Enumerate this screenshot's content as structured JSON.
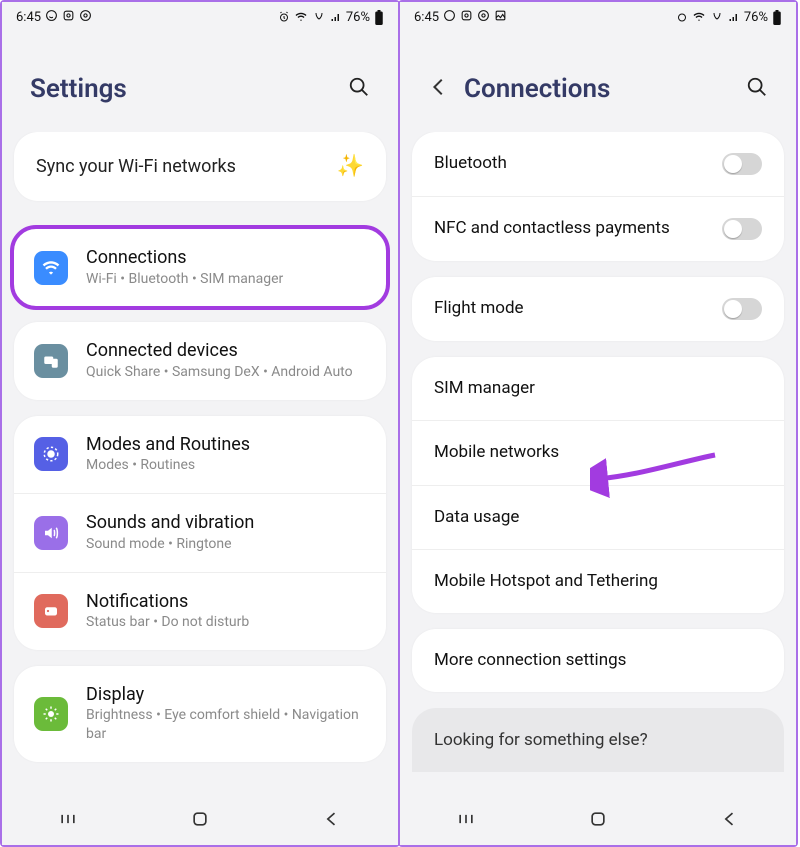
{
  "status": {
    "time": "6:45",
    "battery": "76%"
  },
  "left": {
    "header_title": "Settings",
    "banner": "Sync your Wi-Fi networks",
    "items": [
      {
        "title": "Connections",
        "sub": "Wi-Fi  •  Bluetooth  •  SIM manager"
      },
      {
        "title": "Connected devices",
        "sub": "Quick Share  •  Samsung DeX  •  Android Auto"
      },
      {
        "title": "Modes and Routines",
        "sub": "Modes  •  Routines"
      },
      {
        "title": "Sounds and vibration",
        "sub": "Sound mode  •  Ringtone"
      },
      {
        "title": "Notifications",
        "sub": "Status bar  •  Do not disturb"
      },
      {
        "title": "Display",
        "sub": "Brightness  •  Eye comfort shield  •  Navigation bar"
      }
    ]
  },
  "right": {
    "header_title": "Connections",
    "bluetooth": "Bluetooth",
    "nfc": "NFC and contactless payments",
    "flight": "Flight mode",
    "sim": "SIM manager",
    "mobile": "Mobile networks",
    "data": "Data usage",
    "hotspot": "Mobile Hotspot and Tethering",
    "more": "More connection settings",
    "looking": "Looking for something else?"
  }
}
